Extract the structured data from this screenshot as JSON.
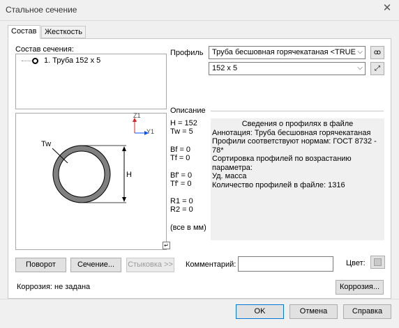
{
  "window": {
    "title": "Стальное сечение"
  },
  "tabs": [
    {
      "label": "Состав",
      "active": true
    },
    {
      "label": "Жесткость",
      "active": false
    }
  ],
  "composition": {
    "label": "Состав сечения:",
    "items": [
      {
        "text": "1. Труба 152 x 5"
      }
    ]
  },
  "preview": {
    "axis_z": "Z1",
    "axis_y": "Y1",
    "label_tw": "Tw",
    "label_h": "H"
  },
  "profile": {
    "label": "Профиль",
    "type_value": "Труба  бесшовная  горячекатаная  <TRUE",
    "size_value": "152 x 5"
  },
  "description": {
    "label": "Описание",
    "params": [
      {
        "text": "H = 152"
      },
      {
        "text": "Tw = 5"
      },
      {
        "text": "Bf = 0"
      },
      {
        "text": "Tf = 0"
      },
      {
        "text": "Bf' = 0"
      },
      {
        "text": "Tf' = 0"
      },
      {
        "text": "R1 = 0"
      },
      {
        "text": "R2 = 0"
      },
      {
        "text": "(все в мм)"
      }
    ],
    "info_title": "Сведения о профилях в файле",
    "info_lines": [
      "Аннотация: Труба  бесшовная  горячекатаная",
      "Профили соответствуют нормам: ГОСТ  8732 - 78*",
      "Сортировка профилей по возрастанию параметра:",
      "Уд. масса",
      "Количество профилей в файле: 1316"
    ]
  },
  "buttons": {
    "rotate": "Поворот",
    "section": "Сечение...",
    "docking": "Стыковка >>",
    "comment_label": "Комментарий:",
    "comment_value": "",
    "color_label": "Цвет:",
    "corrosion_btn": "Коррозия...",
    "ok": "OK",
    "cancel": "Отмена",
    "help": "Справка"
  },
  "status": {
    "corrosion": "Коррозия: не задана"
  },
  "colors": {
    "accent": "#0078d7",
    "axis_y": "#0050ff",
    "axis_z": "#e02020",
    "pipe": "#808080"
  }
}
